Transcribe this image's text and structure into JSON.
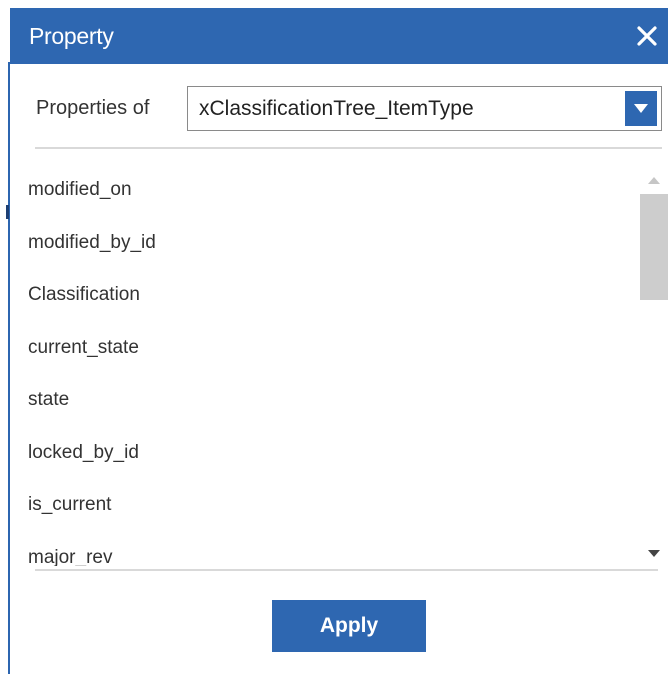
{
  "dialog": {
    "title": "Property",
    "close_icon": "close-icon",
    "colors": {
      "header": "#2e67b1",
      "accent": "#2e67b1",
      "text": "#333333"
    }
  },
  "properties_of": {
    "label": "Properties of",
    "selected": "xClassificationTree_ItemType",
    "dropdown_icon": "chevron-down-icon"
  },
  "property_list": {
    "items": [
      "modified_on",
      "modified_by_id",
      "Classification",
      "current_state",
      "state",
      "locked_by_id",
      "is_current",
      "major_rev"
    ]
  },
  "actions": {
    "apply_label": "Apply"
  }
}
